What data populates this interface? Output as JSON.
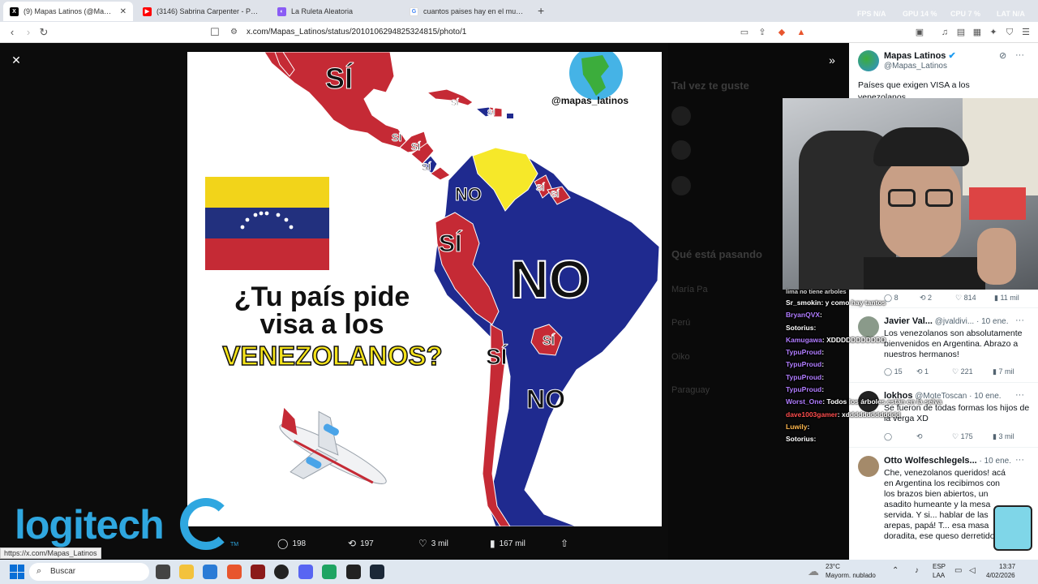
{
  "browser": {
    "tabs": [
      {
        "title": "(9) Mapas Latinos (@Mapas_Lati",
        "fav": "X",
        "fav_color": "#000000"
      },
      {
        "title": "(3146) Sabrina Carpenter - Please",
        "fav": "▶",
        "fav_color": "#ff0000"
      },
      {
        "title": "La Ruleta Aleatoria",
        "fav": "◐",
        "fav_color": "#8a5cf5"
      },
      {
        "title": "cuantos paises hay en el mundo - Bu",
        "fav": "G",
        "fav_color": "#4285f4"
      }
    ],
    "new_tab": "+",
    "hud": {
      "fps_label": "FPS",
      "fps_val": "N/A",
      "gpu_label": "GPU",
      "gpu_val": "14 %",
      "cpu_label": "CPU",
      "cpu_val": "7 %",
      "lat_label": "LAT",
      "lat_val": "N/A"
    },
    "url": "x.com/Mapas_Latinos/status/2010106294825324815/photo/1",
    "status_url": "https://x.com/Mapas_Latinos"
  },
  "map": {
    "handle": "@mapas_latinos",
    "question_line1": "¿Tu país pide",
    "question_line2": "visa a los",
    "question_line3": "VENEZOLANOS?",
    "labels": {
      "mexico": "SÍ",
      "cuba": "SÍ",
      "dr": "SÍ",
      "guatemala": "SÍ",
      "honduras": "SÍ",
      "nicaragua": "SÍ",
      "colombia": "NO",
      "guyana": "SÍ",
      "suriname": "SÍ",
      "peru": "SÍ",
      "brazil": "NO",
      "paraguay": "SÍ",
      "chile": "SÍ",
      "argentina": "NO"
    },
    "colors": {
      "yes": "#c52a35",
      "no": "#1f2a8f",
      "venezuela": "#f6e829"
    }
  },
  "tweet_actions": {
    "replies": "198",
    "retweets": "197",
    "likes": "3 mil",
    "views": "167 mil"
  },
  "overlay": {
    "brand": "logitech",
    "brand_tm": "TM"
  },
  "panel": {
    "author_name": "Mapas Latinos",
    "author_handle": "@Mapas_Latinos",
    "tweet_text_1": "Países que exigen VISA a los",
    "tweet_text_2": "venezolanos",
    "reply_metrics_top": {
      "replies": "8",
      "retweets": "2",
      "likes": "814",
      "views": "11 mil"
    },
    "replies": [
      {
        "name": "Javier Val...",
        "handle": "@jvaldivi...",
        "date": "· 10 ene.",
        "text": "Los venezolanos son absolutamente bienvenidos en Argentina. Abrazo a nuestros hermanos!",
        "replies": "15",
        "retweets": "1",
        "likes": "221",
        "views": "7 mil"
      },
      {
        "name": "lokhos",
        "handle": "@MoteToscan",
        "date": "· 10 ene.",
        "text": "Se fueron de todas formas los hijos de la verga XD",
        "replies": "",
        "retweets": "",
        "likes": "175",
        "views": "3 mil"
      },
      {
        "name": "Otto Wolfeschlegels...",
        "handle": "",
        "date": "· 10 ene.",
        "text": "Che, venezolanos queridos! acá en Argentina los recibimos con los brazos bien abiertos, un asadito humeante y la mesa servida. Y si... hablar de las arepas, papá! T... esa masa doradita, ese queso derretido.",
        "replies": "",
        "retweets": "",
        "likes": "",
        "views": ""
      }
    ],
    "more": "···"
  },
  "background_ghost": {
    "maybe_like": "Tal vez te guste",
    "whats_happening": "Qué está pasando",
    "trend1": "María Pa",
    "trend2": "Perú",
    "trend3": "Oiko",
    "trend4": "Paraguay"
  },
  "chat": [
    {
      "user": "Sr_smokin",
      "color": "#ffffff",
      "msg": ": y como hay tantos"
    },
    {
      "user": "BryanQVX",
      "color": "#b07cff",
      "msg": ":"
    },
    {
      "user": "Sotorius",
      "color": "#ffffff",
      "msg": ":"
    },
    {
      "user": "Kamugawa",
      "color": "#b07cff",
      "msg": ": XDDDDDDDDDDD"
    },
    {
      "user": "TypuProud",
      "color": "#b07cff",
      "msg": ":"
    },
    {
      "user": "TypuProud",
      "color": "#b07cff",
      "msg": ":"
    },
    {
      "user": "TypuProud",
      "color": "#b07cff",
      "msg": ":"
    },
    {
      "user": "TypuProud",
      "color": "#b07cff",
      "msg": ":"
    },
    {
      "user": "Worst_One",
      "color": "#b07cff",
      "msg": ": Todos los árboles están en la selva"
    },
    {
      "user": "dave1003gamer",
      "color": "#ff4d4d",
      "msg": ": xddddddddddddd"
    },
    {
      "user": "Luwily",
      "color": "#ffb84d",
      "msg": ":"
    },
    {
      "user": "Sotorius",
      "color": "#ffffff",
      "msg": ":"
    }
  ],
  "chat_top": "lima no tiene arboles",
  "taskbar": {
    "search": "Buscar",
    "weather_temp": "23°C",
    "weather_desc": "Mayorm. nublado",
    "lang1": "ESP",
    "lang2": "LAA",
    "time": "13:37",
    "date": "4/02/2026"
  }
}
